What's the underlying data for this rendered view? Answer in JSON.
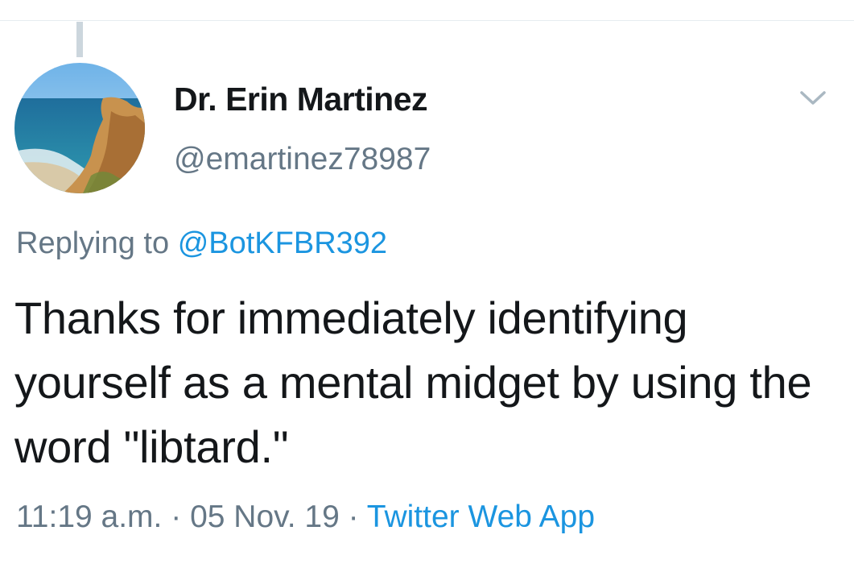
{
  "tweet": {
    "display_name": "Dr. Erin Martinez",
    "handle": "@emartinez78987",
    "reply_prefix": "Replying to",
    "reply_to": "@BotKFBR392",
    "text": "Thanks for immediately identifying yourself as a mental midget by using the word \"libtard.\"",
    "time": "11:19 a.m.",
    "separator": "·",
    "date": "05 Nov. 19",
    "source": "Twitter Web App"
  },
  "icons": {
    "menu": "chevron-down-icon",
    "avatar": "beach-cliff-photo"
  },
  "colors": {
    "text": "#14171a",
    "secondary": "#657786",
    "link": "#1b95e0",
    "thread_line": "#ccd6dd"
  }
}
